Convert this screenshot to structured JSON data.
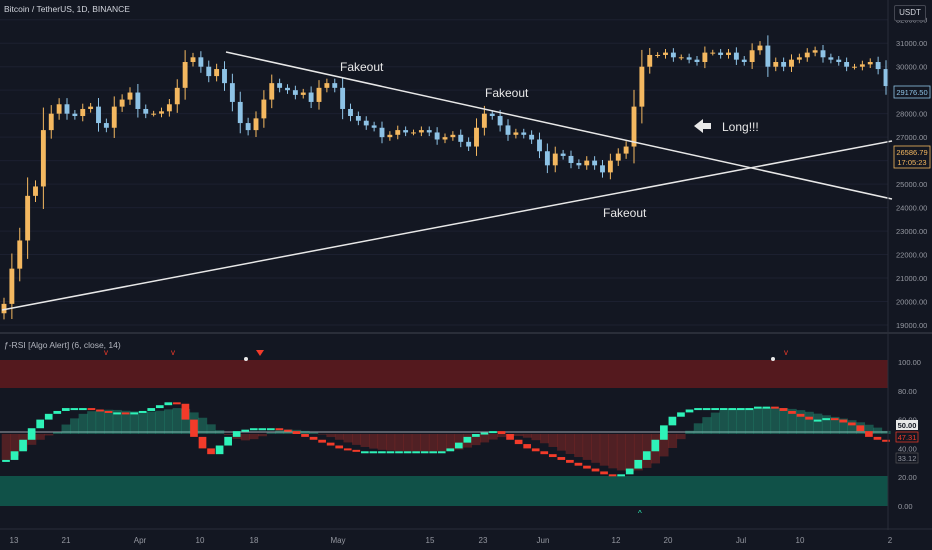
{
  "header": {
    "symbol": "Bitcoin / TetherUS, 1D, BINANCE",
    "currency": "USDT"
  },
  "indicator": {
    "title": "ƒ-RSI [Algo Alert] (6, close, 14)"
  },
  "price_axis": {
    "ticks": [
      "32000.00",
      "31000.00",
      "30000.00",
      "29000.00",
      "28000.00",
      "27000.00",
      "26000.00",
      "25000.00",
      "24000.00",
      "23000.00",
      "22000.00",
      "21000.00",
      "20000.00",
      "19000.00"
    ],
    "current_price": "29176.50",
    "mark_price": "26586.79",
    "countdown": "17:05:23"
  },
  "rsi_axis": {
    "ticks": [
      "100.00",
      "80.00",
      "60.00",
      "40.00",
      "20.00",
      "0.00"
    ],
    "labels": [
      "50.00",
      "47.31",
      "33.12"
    ]
  },
  "time_axis": {
    "ticks": [
      "13",
      "21",
      "Apr",
      "10",
      "18",
      "May",
      "15",
      "23",
      "Jun",
      "12",
      "20",
      "Jul",
      "10",
      "2"
    ]
  },
  "annotations": {
    "fakeout_1": "Fakeout",
    "fakeout_2": "Fakeout",
    "fakeout_3": "Fakeout",
    "long": "Long!!!"
  },
  "colors": {
    "background": "#131722",
    "up": "#f4b860",
    "down": "#8ec3e6",
    "rsi_up": "#2ef2b8",
    "rsi_down": "#f23b2a",
    "overbought_band": "#8a1c1c",
    "oversold_band": "#0f6b58"
  },
  "chart_data": [
    {
      "type": "candlestick",
      "title": "Bitcoin / TetherUS, 1D, BINANCE",
      "ylim": [
        19000,
        32500
      ],
      "x": [
        "13",
        "21",
        "Apr",
        "10",
        "18",
        "May",
        "15",
        "23",
        "Jun",
        "12",
        "20",
        "Jul",
        "10",
        "2"
      ],
      "close": [
        19900,
        21400,
        22600,
        24500,
        24900,
        27300,
        28000,
        28400,
        28000,
        27900,
        28200,
        28300,
        27600,
        27400,
        28300,
        28600,
        28900,
        28200,
        28000,
        28000,
        28100,
        28400,
        29100,
        30200,
        30400,
        30000,
        29600,
        29900,
        29300,
        28500,
        27600,
        27300,
        27800,
        28600,
        29300,
        29100,
        29000,
        28800,
        28900,
        28500,
        29100,
        29300,
        29100,
        28200,
        27900,
        27700,
        27500,
        27400,
        27000,
        27100,
        27300,
        27200,
        27200,
        27300,
        27200,
        26900,
        27000,
        27100,
        26800,
        26600,
        27400,
        28000,
        27900,
        27500,
        27100,
        27200,
        27100,
        26900,
        26400,
        25800,
        26300,
        26200,
        25900,
        25800,
        26000,
        25800,
        25500,
        26000,
        26300,
        26600,
        28300,
        30000,
        30500,
        30500,
        30600,
        30400,
        30400,
        30300,
        30200,
        30600,
        30600,
        30500,
        30600,
        30300,
        30200,
        30700,
        30900,
        30000,
        30200,
        30000,
        30300,
        30400,
        30600,
        30700,
        30400,
        30300,
        30200,
        30000,
        30000,
        30100,
        30200,
        29900,
        29176.5
      ]
    },
    {
      "type": "line",
      "title": "ƒ-RSI [Algo Alert] (6, close, 14)",
      "ylim": [
        0,
        100
      ],
      "series": [
        {
          "values": [
            32,
            38,
            46,
            54,
            60,
            64,
            66,
            68,
            68,
            68,
            67,
            66,
            65,
            65,
            64,
            65,
            66,
            68,
            70,
            72,
            71,
            60,
            48,
            40,
            36,
            42,
            48,
            52,
            53,
            54,
            54,
            54,
            53,
            52,
            50,
            48,
            46,
            44,
            42,
            40,
            39,
            38,
            38,
            38,
            38,
            38,
            38,
            38,
            38,
            38,
            38,
            38,
            40,
            44,
            48,
            50,
            51,
            52,
            50,
            46,
            43,
            40,
            38,
            36,
            34,
            32,
            30,
            28,
            26,
            24,
            22,
            21,
            22,
            26,
            32,
            38,
            46,
            56,
            62,
            65,
            67,
            68,
            68,
            68,
            68,
            68,
            68,
            68,
            69,
            69,
            68,
            66,
            64,
            62,
            60,
            60,
            61,
            60,
            58,
            56,
            52,
            48,
            46,
            45
          ]
        }
      ]
    }
  ]
}
